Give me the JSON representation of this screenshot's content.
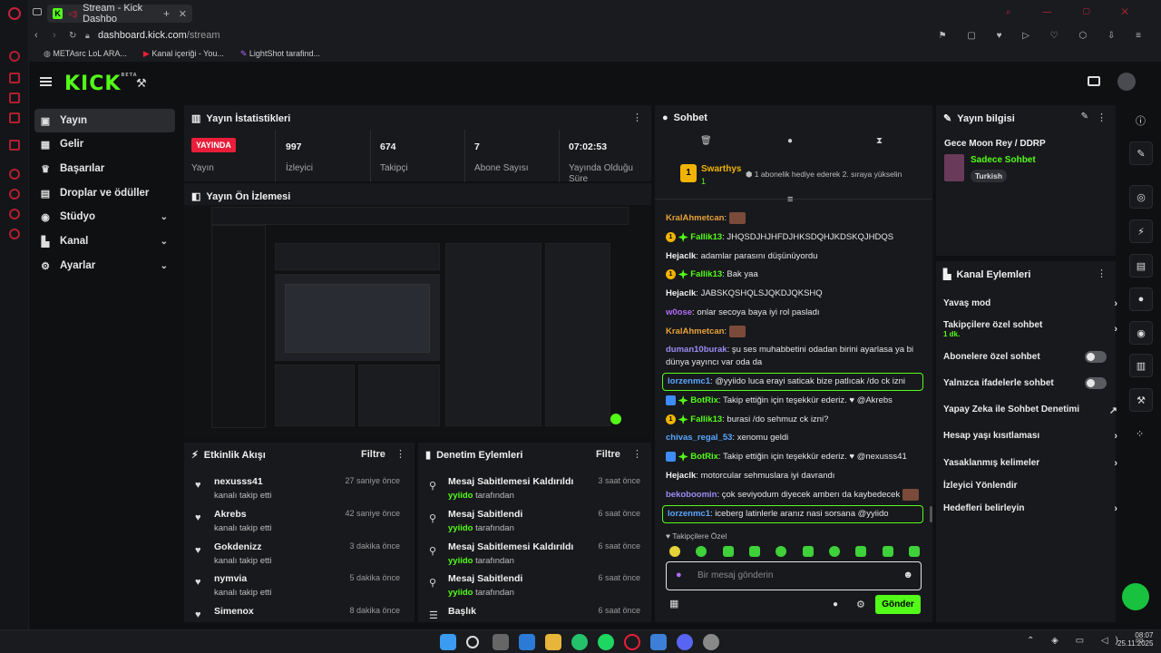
{
  "browser": {
    "tab_title": "Stream - Kick Dashbo",
    "url_host": "dashboard.kick.com",
    "url_path": "/stream",
    "bookmarks": [
      "METAsrc LoL ARA...",
      "Kanal içeriği - You...",
      "LightShot tarafind..."
    ]
  },
  "header": {
    "logo": "KICK",
    "logo_sup": "BETA"
  },
  "nav": {
    "items": [
      {
        "label": "Yayın",
        "icon": "broadcast-icon"
      },
      {
        "label": "Gelir",
        "icon": "revenue-icon"
      },
      {
        "label": "Başarılar",
        "icon": "trophy-icon"
      },
      {
        "label": "Droplar ve ödüller",
        "icon": "gift-icon"
      },
      {
        "label": "Stüdyo",
        "icon": "studio-icon"
      },
      {
        "label": "Kanal",
        "icon": "channel-icon"
      },
      {
        "label": "Ayarlar",
        "icon": "gear-icon"
      }
    ]
  },
  "stats": {
    "title": "Yayın İstatistikleri",
    "live_badge": "YAYINDA",
    "live_label": "Yayın",
    "viewers": "997",
    "viewers_label": "İzleyici",
    "followers": "674",
    "followers_label": "Takipçi",
    "subs": "7",
    "subs_label": "Abone Sayısı",
    "duration": "07:02:53",
    "duration_label": "Yayında Olduğu Süre"
  },
  "preview": {
    "title": "Yayın Ön İzlemesi"
  },
  "activity": {
    "title": "Etkinlik Akışı",
    "filter": "Filtre",
    "items": [
      {
        "name": "nexusss41",
        "sub": "kanalı takip etti",
        "time": "27 saniye önce"
      },
      {
        "name": "Akrebs",
        "sub": "kanalı takip etti",
        "time": "42 saniye önce"
      },
      {
        "name": "Gokdenizz",
        "sub": "kanalı takip etti",
        "time": "3 dakika önce"
      },
      {
        "name": "nymvia",
        "sub": "kanalı takip etti",
        "time": "5 dakika önce"
      },
      {
        "name": "Simenox",
        "sub": "",
        "time": "8 dakika önce"
      }
    ]
  },
  "moderation": {
    "title": "Denetim Eylemleri",
    "filter": "Filtre",
    "items": [
      {
        "name": "Mesaj Sabitlemesi Kaldırıldı",
        "by": "yyiido",
        "suffix": "tarafından",
        "time": "3 saat önce"
      },
      {
        "name": "Mesaj Sabitlendi",
        "by": "yyiido",
        "suffix": "tarafından",
        "time": "6 saat önce"
      },
      {
        "name": "Mesaj Sabitlemesi Kaldırıldı",
        "by": "yyiido",
        "suffix": "tarafından",
        "time": "6 saat önce"
      },
      {
        "name": "Mesaj Sabitlendi",
        "by": "yyiido",
        "suffix": "tarafından",
        "time": "6 saat önce"
      },
      {
        "name": "Başlık",
        "by": "",
        "suffix": "",
        "time": "6 saat önce"
      }
    ]
  },
  "chat": {
    "title": "Sohbet",
    "gift_user": "Swarthys",
    "gift_count": "1",
    "gift_text": "1 abonelik hediye ederek 2. sıraya yükselin",
    "messages": [
      {
        "user": "KralAhmetcan",
        "color": "#e8a23a",
        "text": ""
      },
      {
        "user": "Fallik13",
        "color": "#53fc18",
        "text": "JHQSDJHJHFDJHKSDQHJKDSKQJHDQS"
      },
      {
        "user": "Hejaclk",
        "color": "#f0f0f0",
        "text": "adamlar parasını düşünüyordu"
      },
      {
        "user": "Fallik13",
        "color": "#53fc18",
        "text": "Bak yaa"
      },
      {
        "user": "Hejaclk",
        "color": "#f0f0f0",
        "text": "JABSKQSHQLSJQKDJQKSHQ"
      },
      {
        "user": "w0ose",
        "color": "#b06cf5",
        "text": "onlar secoya baya iyi rol pasladı"
      },
      {
        "user": "KralAhmetcan",
        "color": "#e8a23a",
        "text": ""
      },
      {
        "user": "duman10burak",
        "color": "#9c8cf5",
        "text": "şu ses muhabbetini odadan birini ayarlasa ya bi dünya yayıncı var oda da"
      },
      {
        "user": "lorzenmc1",
        "color": "#5aa6ff",
        "text": "@yyiido luca erayi saticak bize patlıcak /do ck izni"
      },
      {
        "user": "BotRix",
        "color": "#53fc18",
        "text": "Takip ettiğin için teşekkür ederiz. ♥ @Akrebs"
      },
      {
        "user": "Fallik13",
        "color": "#53fc18",
        "text": "burasi /do sehmuz ck izni?"
      },
      {
        "user": "chivas_regal_53",
        "color": "#5aa6ff",
        "text": "xenomu geldi"
      },
      {
        "user": "BotRix",
        "color": "#53fc18",
        "text": "Takip ettiğin için teşekkür ederiz. ♥ @nexusss41"
      },
      {
        "user": "Hejaclk",
        "color": "#f0f0f0",
        "text": "motorcular sehmuslara iyi davrandı"
      },
      {
        "user": "bekoboomin",
        "color": "#9c8cf5",
        "text": "çok seviyodum diyecek amberı da kaybedecek"
      },
      {
        "user": "lorzenmc1",
        "color": "#5aa6ff",
        "text": "iceberg latinlerle aranız nasi sorsana @yyiido"
      }
    ],
    "followers_only": "Takipçilere Özel",
    "input_placeholder": "Bir mesaj gönderin",
    "send": "Gönder"
  },
  "stream_info": {
    "title": "Yayın bilgisi",
    "stream_title": "Gece Moon Rey / DDRP",
    "category": "Sadece Sohbet",
    "language": "Turkish"
  },
  "channel_actions": {
    "title": "Kanal Eylemleri",
    "slow_mode": "Yavaş mod",
    "followers_chat": "Takipçilere özel sohbet",
    "followers_chat_sub": "1 dk.",
    "subs_chat": "Abonelere özel sohbet",
    "emotes_chat": "Yalnızca ifadelerle sohbet",
    "ai_mod": "Yapay Zeka ile Sohbet Denetimi",
    "age_restrict": "Hesap yaşı kısıtlaması",
    "banned_words": "Yasaklanmış kelimeler",
    "raid": "İzleyici Yönlendir",
    "goals": "Hedefleri belirleyin"
  },
  "taskbar": {
    "time": "08:07",
    "date": "25.11.2025"
  },
  "colors": {
    "accent": "#53fc18",
    "live": "#e91e3a",
    "panel": "#18191c"
  }
}
